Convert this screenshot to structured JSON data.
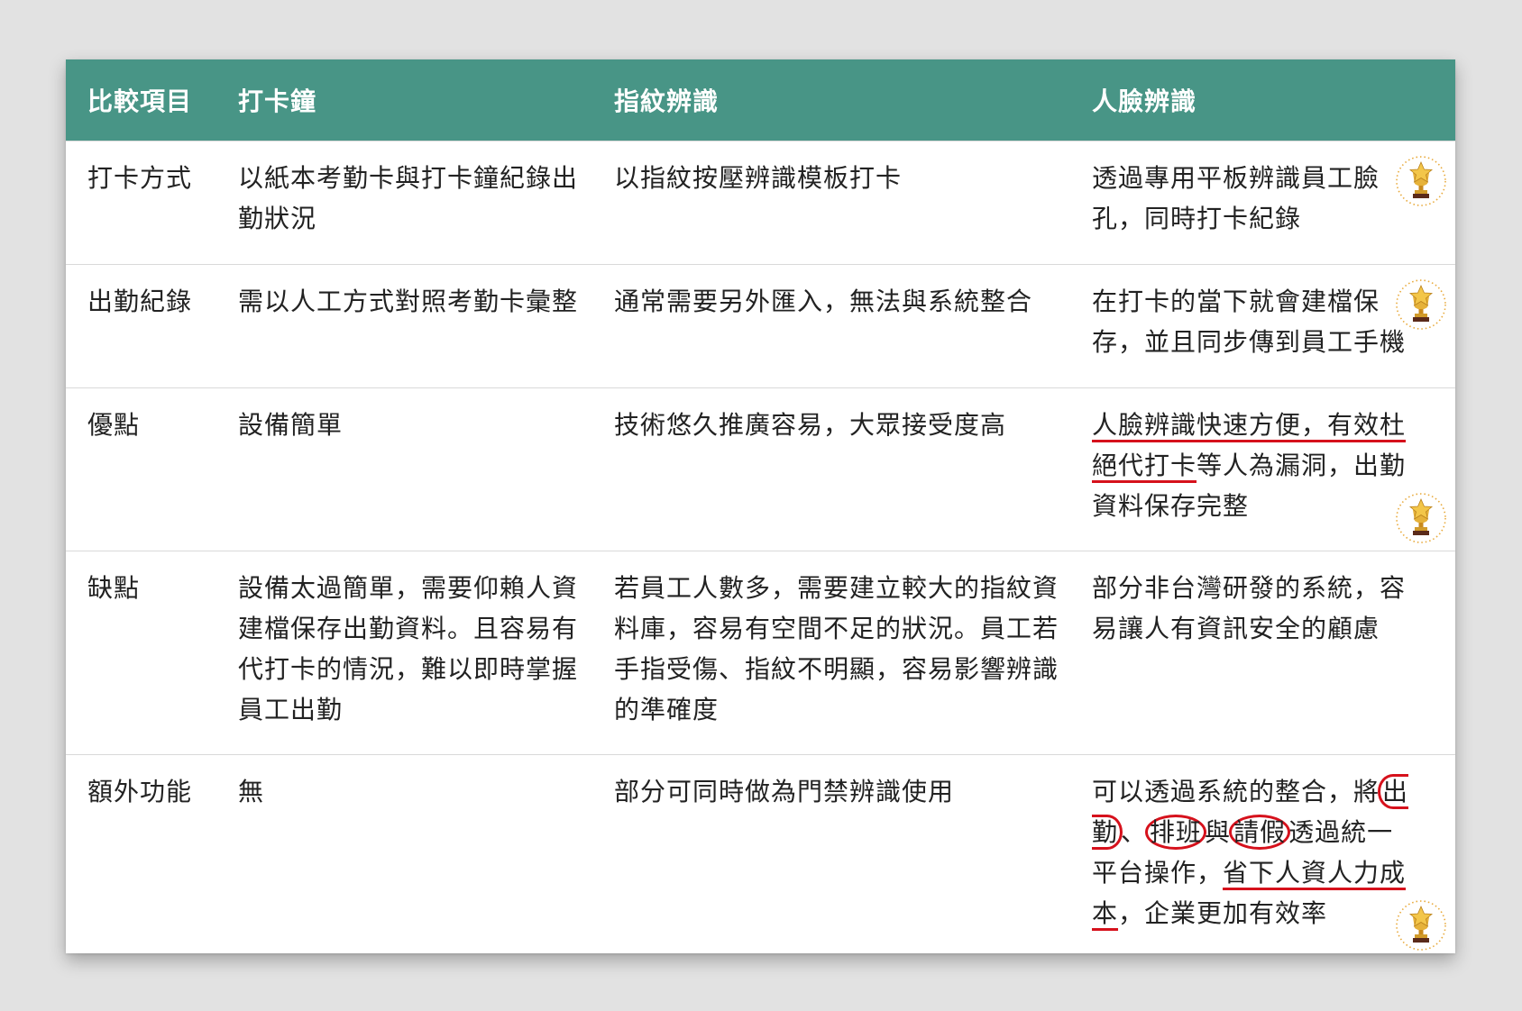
{
  "headers": [
    "比較項目",
    "打卡鐘",
    "指紋辨識",
    "人臉辨識"
  ],
  "rows": [
    {
      "item": "打卡方式",
      "clock": "以紙本考勤卡與打卡鐘紀錄出勤狀況",
      "fingerprint": "以指紋按壓辨識模板打卡",
      "face": "透過專用平板辨識員工臉孔，同時打卡紀錄"
    },
    {
      "item": "出勤紀錄",
      "clock": "需以人工方式對照考勤卡彙整",
      "fingerprint": "通常需要另外匯入，無法與系統整合",
      "face": "在打卡的當下就會建檔保存，並且同步傳到員工手機"
    },
    {
      "item": "優點",
      "clock": "設備簡單",
      "fingerprint": "技術悠久推廣容易，大眾接受度高",
      "face": {
        "underlined_1": "人臉辨識快速方便，有效杜絕代打卡",
        "rest_1": "等人為漏洞，出勤資料保存完整"
      }
    },
    {
      "item": "缺點",
      "clock": "設備太過簡單，需要仰賴人資建檔保存出勤資料。且容易有代打卡的情況，難以即時掌握員工出勤",
      "fingerprint": "若員工人數多，需要建立較大的指紋資料庫，容易有空間不足的狀況。員工若手指受傷、指紋不明顯，容易影響辨識的準確度",
      "face": "部分非台灣研發的系統，容易讓人有資訊安全的顧慮"
    },
    {
      "item": "額外功能",
      "clock": "無",
      "fingerprint": "部分可同時做為門禁辨識使用",
      "face": {
        "p1": "可以透過系統的整合，將",
        "circled_1": "出勤",
        "p2": "、",
        "circled_2": "排班",
        "p3": "與",
        "circled_3": "請假",
        "p4": "透過統一平台操作，",
        "underlined_1": "省下人資人力成本",
        "p5": "，企業更加有效率"
      }
    }
  ],
  "colors": {
    "header_bg": "#489586",
    "header_text": "#ffffff",
    "highlight_red": "#d6111c",
    "page_bg": "#e2e2e2"
  },
  "icons": [
    "trophy-icon"
  ]
}
